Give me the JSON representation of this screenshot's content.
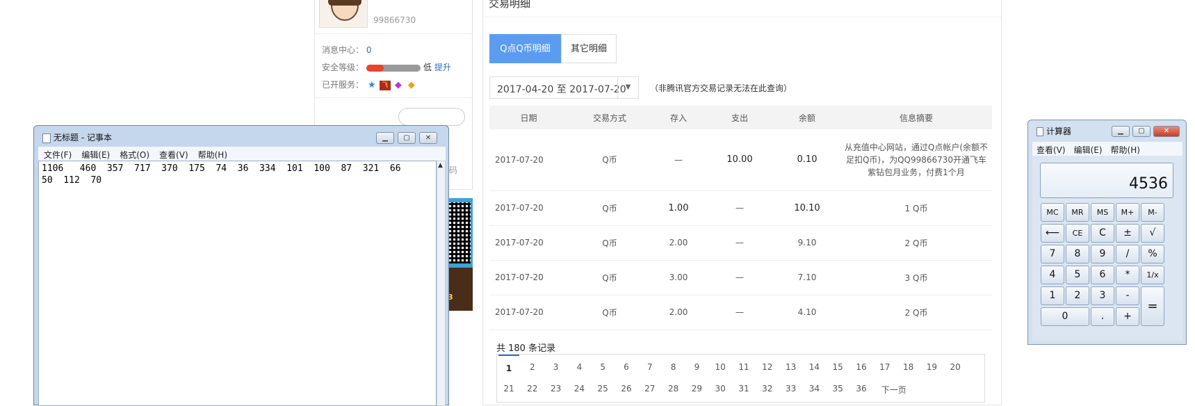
{
  "profile": {
    "qq_number": "99866730",
    "msg_label": "消息中心：",
    "msg_count": "0",
    "security_label": "安全等级：",
    "security_level": "低",
    "security_improve": "提升",
    "security_fill": 0.32,
    "services_label": "已开服务：",
    "services": [
      "blue-diamond-icon",
      "racing-car-icon",
      "purple-diamond-icon",
      "yellow-diamond-icon"
    ],
    "qr_tag": "3"
  },
  "transactions": {
    "title": "交易明细",
    "tabs": [
      "Q点Q币明细",
      "其它明细"
    ],
    "date_range": "2017-04-20 至 2017-07-20",
    "notice": "（非腾讯官方交易记录无法在此查询）",
    "columns": [
      "日期",
      "交易方式",
      "存入",
      "支出",
      "余额",
      "信息摘要"
    ],
    "rows": [
      {
        "date": "2017-07-20",
        "method": "Q币",
        "in": "—",
        "out": "10.00",
        "balance": "0.10",
        "memo": "从充值中心网站，通过Q点帐户(余额不足扣Q币)，为QQ99866730开通飞车紫钻包月业务，付费1个月"
      },
      {
        "date": "2017-07-20",
        "method": "Q币",
        "in": "1.00",
        "out": "—",
        "balance": "10.10",
        "memo": "1 Q币"
      },
      {
        "date": "2017-07-20",
        "method": "Q币",
        "in": "2.00",
        "out": "—",
        "balance": "9.10",
        "memo": "2 Q币"
      },
      {
        "date": "2017-07-20",
        "method": "Q币",
        "in": "3.00",
        "out": "—",
        "balance": "7.10",
        "memo": "3 Q币"
      },
      {
        "date": "2017-07-20",
        "method": "Q币",
        "in": "2.00",
        "out": "—",
        "balance": "4.10",
        "memo": "2 Q币"
      }
    ],
    "total_label": "共 180 条记录",
    "pages_row1": [
      "1",
      "2",
      "3",
      "4",
      "5",
      "6",
      "7",
      "8",
      "9",
      "10",
      "11",
      "12",
      "13",
      "14",
      "15",
      "16",
      "17",
      "18",
      "19",
      "20"
    ],
    "pages_row2": [
      "21",
      "22",
      "23",
      "24",
      "25",
      "26",
      "27",
      "28",
      "29",
      "30",
      "31",
      "32",
      "33",
      "34",
      "35",
      "36",
      "下一页"
    ]
  },
  "notepad": {
    "title": "无标题 - 记事本",
    "menu": [
      "文件(F)",
      "编辑(E)",
      "格式(O)",
      "查看(V)",
      "帮助(H)"
    ],
    "text": "1106   460  357  717  370  175  74  36  334  101  100  87  321  66\n50  112  70",
    "behind_text": "码"
  },
  "calculator": {
    "title": "计算器",
    "menu": [
      "查看(V)",
      "编辑(E)",
      "帮助(H)"
    ],
    "display": "4536",
    "keys": [
      "MC",
      "MR",
      "MS",
      "M+",
      "M-",
      "⟵",
      "CE",
      "C",
      "±",
      "√",
      "7",
      "8",
      "9",
      "/",
      "%",
      "4",
      "5",
      "6",
      "*",
      "1/x",
      "1",
      "2",
      "3",
      "-",
      "=",
      "0",
      ".",
      "+"
    ]
  },
  "window_buttons": {
    "minimize": "minimize-icon",
    "maximize": "maximize-icon",
    "close": "close-icon"
  }
}
